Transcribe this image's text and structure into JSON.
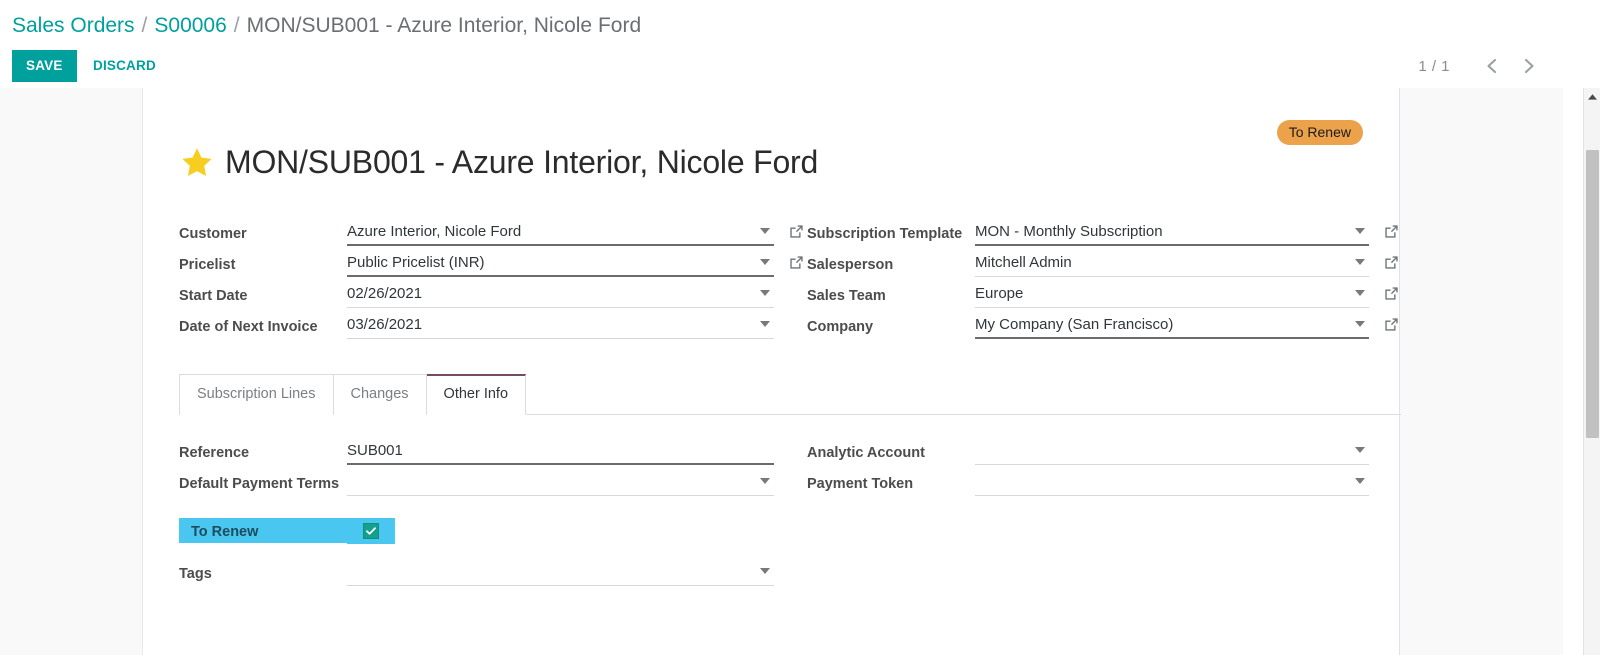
{
  "breadcrumb": {
    "root": "Sales Orders",
    "parent": "S00006",
    "current": "MON/SUB001 - Azure Interior, Nicole Ford",
    "separator": "/"
  },
  "controls": {
    "save_label": "SAVE",
    "discard_label": "DISCARD",
    "pager_count": "1 / 1",
    "prev_icon": "chevron-left-icon",
    "next_icon": "chevron-right-icon"
  },
  "record": {
    "badge": "To Renew",
    "star_icon": "star-filled-icon",
    "title": "MON/SUB001 - Azure Interior, Nicole Ford"
  },
  "form_left": [
    {
      "label": "Customer",
      "value": "Azure Interior, Nicole Ford",
      "required": true,
      "has_external": true
    },
    {
      "label": "Pricelist",
      "value": "Public Pricelist (INR)",
      "required": true,
      "has_external": true
    },
    {
      "label": "Start Date",
      "value": "02/26/2021",
      "required": false,
      "has_external": false
    },
    {
      "label": "Date of Next Invoice",
      "value": "03/26/2021",
      "required": false,
      "has_external": false
    }
  ],
  "form_right": [
    {
      "label": "Subscription Template",
      "value": "MON - Monthly Subscription",
      "required": true,
      "has_external": true
    },
    {
      "label": "Salesperson",
      "value": "Mitchell Admin",
      "required": false,
      "has_external": true
    },
    {
      "label": "Sales Team",
      "value": "Europe",
      "required": false,
      "has_external": true
    },
    {
      "label": "Company",
      "value": "My Company (San Francisco)",
      "required": true,
      "has_external": true
    }
  ],
  "tabs": [
    {
      "label": "Subscription Lines",
      "active": false
    },
    {
      "label": "Changes",
      "active": false
    },
    {
      "label": "Other Info",
      "active": true
    }
  ],
  "other_info_left": [
    {
      "label": "Reference",
      "value": "SUB001",
      "type": "text",
      "required": true
    },
    {
      "label": "Default Payment Terms",
      "value": "",
      "type": "select",
      "required": false
    },
    {
      "label": "To Renew",
      "value": "",
      "type": "checkbox",
      "checked": true,
      "highlighted": true
    },
    {
      "label": "Tags",
      "value": "",
      "type": "select",
      "required": false
    }
  ],
  "other_info_right": [
    {
      "label": "Analytic Account",
      "value": "",
      "type": "select"
    },
    {
      "label": "Payment Token",
      "value": "",
      "type": "select"
    }
  ],
  "colors": {
    "accent_teal": "#00a09d",
    "badge_orange": "#eca14b",
    "highlight_blue": "#4ac7f0",
    "checkbox_green": "#13a08f",
    "active_tab_border": "#714b67",
    "star_yellow": "#f7cd1f"
  },
  "scrollbar": {
    "up_arrow_icon": "scroll-up-arrow-icon"
  }
}
